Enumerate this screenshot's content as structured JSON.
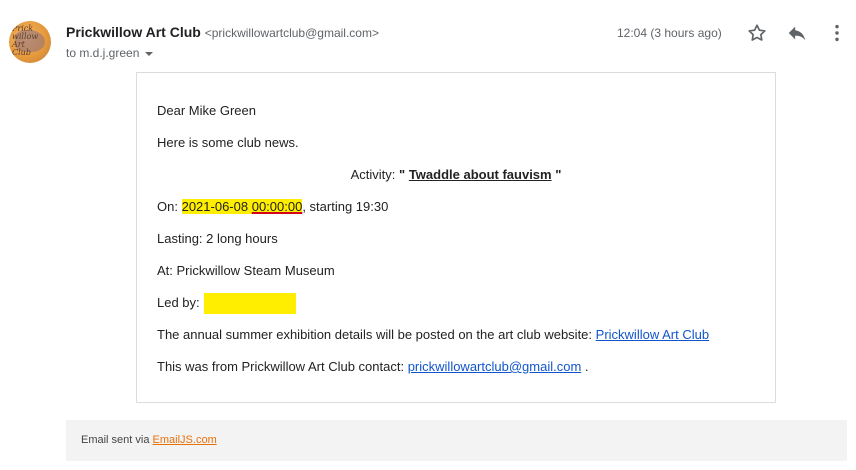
{
  "sender": {
    "avatar_text": "Prickwillow Art Club",
    "name": "Prickwillow Art Club",
    "email": "<prickwillowartclub@gmail.com>",
    "to": "to m.d.j.green",
    "time": "12:04 (3 hours ago)"
  },
  "icons": {
    "star": "star-icon",
    "reply": "reply-icon",
    "more": "more-vert-icon"
  },
  "body": {
    "greeting": "Dear Mike Green",
    "intro": "Here is some club news.",
    "activity_label": "Activity:",
    "activity_open_quote": "\"",
    "activity_name": "Twaddle about fauvism",
    "activity_close_quote": "\"",
    "on_label": "On:",
    "date": "2021-06-08",
    "time": "00:00:00",
    "starting": ", starting 19:30",
    "lasting": "Lasting: 2 long hours",
    "at": "At:  Prickwillow Steam Museum",
    "led_by": "Led by:",
    "exhibition_text": "The annual summer exhibition details will be posted on the art club website:",
    "website_link": "Prickwillow Art Club",
    "contact_text": "This was from Prickwillow Art Club contact:",
    "contact_link": "prickwillowartclub@gmail.com",
    "contact_end": "."
  },
  "footer": {
    "text": "Email sent via",
    "link": "EmailJS.com"
  },
  "colors": {
    "highlight": "#ffee00",
    "link": "#1155cc",
    "footer_link": "#e8710a",
    "underline_mark": "#d0021b"
  }
}
